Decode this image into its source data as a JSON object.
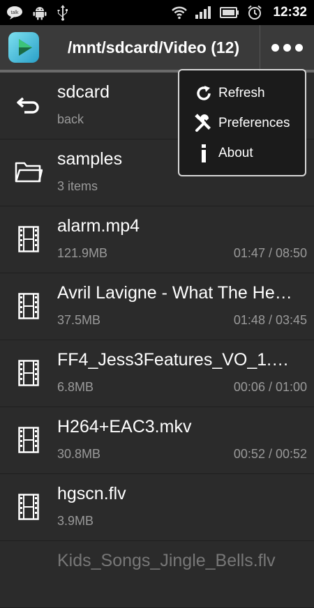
{
  "status_bar": {
    "time": "12:32",
    "talk_label": "talk",
    "icons": [
      "talk-icon",
      "android-icon",
      "usb-icon",
      "wifi-icon",
      "signal-icon",
      "battery-icon",
      "alarm-icon"
    ]
  },
  "action_bar": {
    "title": "/mnt/sdcard/Video (12)"
  },
  "menu": {
    "items": [
      {
        "label": "Refresh",
        "icon": "refresh-icon"
      },
      {
        "label": "Preferences",
        "icon": "tools-icon"
      },
      {
        "label": "About",
        "icon": "info-icon"
      }
    ]
  },
  "files": [
    {
      "name": "sdcard",
      "sub": "back",
      "time": "",
      "icon": "back-icon"
    },
    {
      "name": "samples",
      "sub": "3 items",
      "time": "",
      "icon": "folder-icon"
    },
    {
      "name": "alarm.mp4",
      "sub": "121.9MB",
      "time": "01:47 / 08:50",
      "icon": "film-icon"
    },
    {
      "name": "Avril Lavigne - What The He…",
      "sub": "37.5MB",
      "time": "01:48 / 03:45",
      "icon": "film-icon"
    },
    {
      "name": "FF4_Jess3Features_VO_1.…",
      "sub": "6.8MB",
      "time": "00:06 / 01:00",
      "icon": "film-icon"
    },
    {
      "name": "H264+EAC3.mkv",
      "sub": "30.8MB",
      "time": "00:52 / 00:52",
      "icon": "film-icon"
    },
    {
      "name": "hgscn.flv",
      "sub": "3.9MB",
      "time": "",
      "icon": "film-icon"
    },
    {
      "name": "Kids_Songs_Jingle_Bells.flv",
      "sub": "",
      "time": "",
      "icon": ""
    }
  ],
  "colors": {
    "background": "#2b2b2b",
    "action_bar": "#3a3a3a",
    "secondary_text": "#9a9a9a",
    "menu_background": "#1b1b1b"
  }
}
